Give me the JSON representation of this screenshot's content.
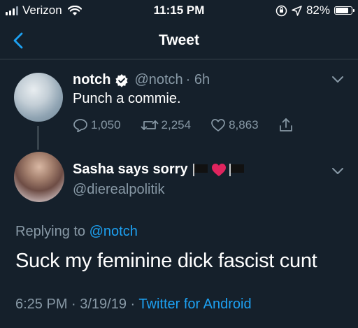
{
  "status_bar": {
    "carrier": "Verizon",
    "time": "11:15 PM",
    "battery": "82%",
    "battery_level": 0.82
  },
  "nav": {
    "title": "Tweet"
  },
  "parent_tweet": {
    "name": "notch",
    "handle": "@notch",
    "age": "· 6h",
    "text": "Punch a commie.",
    "replies": "1,050",
    "retweets": "2,254",
    "likes": "8,863"
  },
  "reply_tweet": {
    "name": "Sasha says sorry",
    "handle": "@dierealpolitik",
    "replying_prefix": "Replying to",
    "replying_handle": "@notch",
    "text": "Suck my feminine dick fascist cunt",
    "timestamp": "6:25 PM · 3/19/19 ·",
    "source": "Twitter for Android"
  },
  "colors": {
    "background": "#15202b",
    "accent": "#1da1f2",
    "secondary_text": "#8899a6",
    "heart": "#e0245e"
  },
  "icons": {
    "back": "chevron-left-icon",
    "verified": "verified-badge-icon",
    "reply": "reply-icon",
    "retweet": "retweet-icon",
    "like": "heart-outline-icon",
    "share": "share-icon",
    "more": "chevron-down-icon"
  }
}
